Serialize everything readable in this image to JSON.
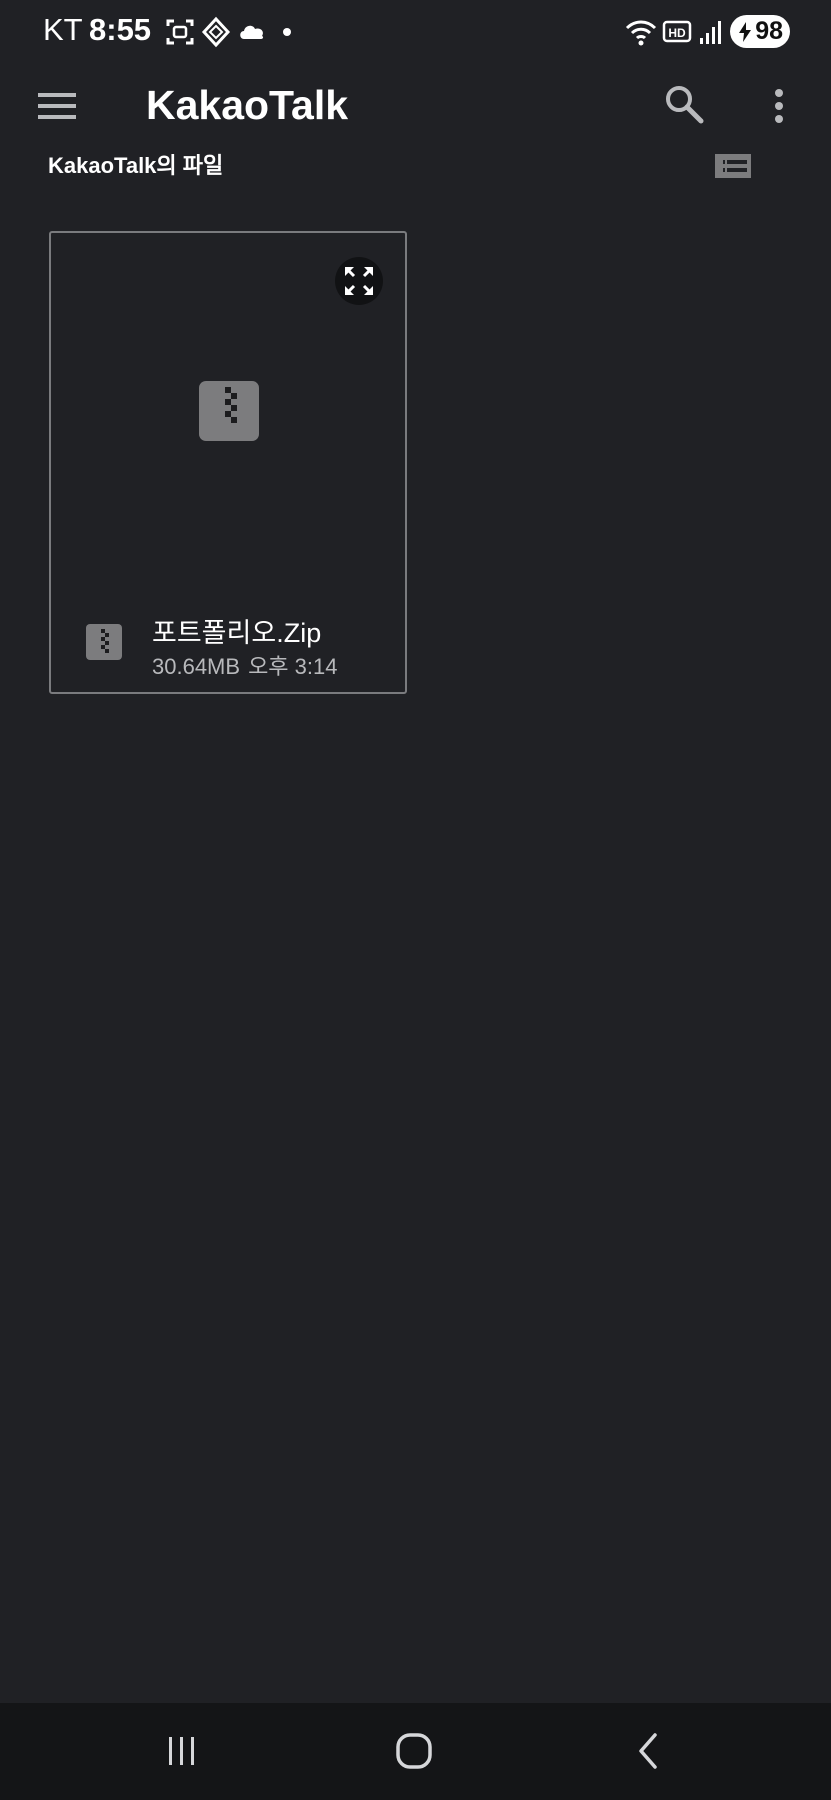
{
  "status_bar": {
    "carrier": "KT",
    "time": "8:55",
    "battery": "98",
    "icons": [
      "screenshot-icon",
      "diamond-app-icon",
      "cloud-icon",
      "notification-dot",
      "wifi-icon",
      "hd-icon",
      "signal-icon",
      "charging-icon"
    ]
  },
  "app_bar": {
    "title": "KakaoTalk",
    "icons": [
      "menu-icon",
      "search-icon",
      "more-vert-icon"
    ]
  },
  "folder": {
    "title": "KakaoTalk의 파일",
    "view_icon": "list-view-icon"
  },
  "files": [
    {
      "name": "포트폴리오.Zip",
      "size": "30.64MB",
      "time": "오후 3:14",
      "icon": "zip-file-icon"
    }
  ],
  "nav_bar": {
    "icons": [
      "recent-apps-icon",
      "home-icon",
      "back-icon"
    ]
  },
  "colors": {
    "background": "#202125",
    "nav_background": "#141517",
    "card_border": "#7a7b7e",
    "icon_gray": "#7c7c7e",
    "secondary_text": "#b8b9bc"
  }
}
